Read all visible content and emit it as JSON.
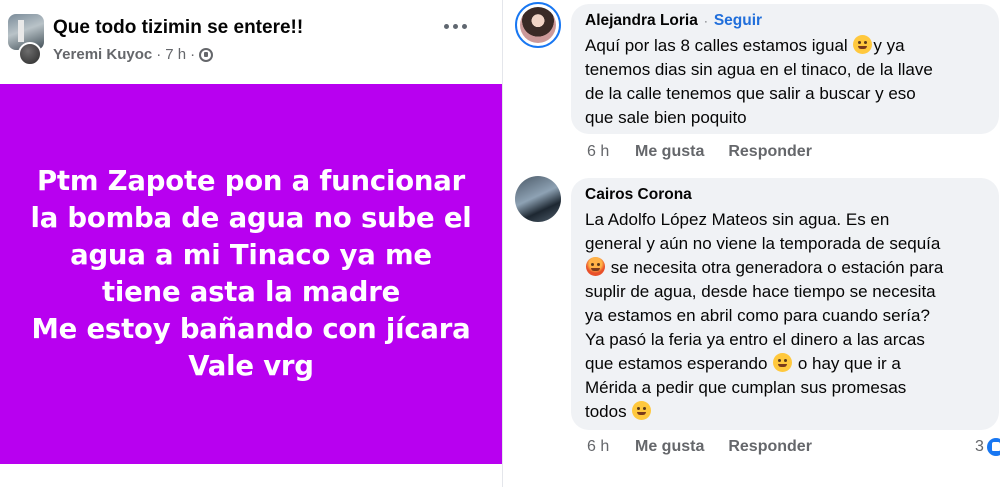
{
  "post": {
    "group_name": "Que todo tizimin se entere!!",
    "author": "Yeremi Kuyoc",
    "separator": "·",
    "time": "7 h",
    "separator2": "·",
    "image_background": "#b800f0",
    "image_text": "Ptm Zapote pon a funcionar\nla bomba de agua no sube el\nagua a mi Tinaco ya me\ntiene asta la madre\nMe estoy bañando con jícara\nVale vrg"
  },
  "comments": [
    {
      "name": "Alejandra Loria",
      "separator": "·",
      "follow_label": "Seguir",
      "text_before_emoji": "Aquí por las 8 calles estamos igual ",
      "emoji": "hugging-face-icon",
      "text_after_emoji": "y ya\ntenemos dias sin agua en el tinaco, de la llave\nde la calle tenemos que salir a buscar y eso\nque sale bien poquito",
      "time": "6 h",
      "like_label": "Me gusta",
      "reply_label": "Responder"
    },
    {
      "name": "Cairos Corona",
      "text_part1": "La Adolfo López Mateos sin agua. Es en\ngeneral y aún no viene la temporada de sequía\n",
      "text_part2": " se necesita otra generadora o estación para\nsuplir de agua, desde hace tiempo se necesita\nya estamos en abril  como para cuando sería?\nYa pasó la feria ya entro el dinero a las arcas\nque estamos esperando ",
      "text_part3": " o hay que ir a\nMérida a pedir que cumplan sus promesas\ntodos ",
      "time": "6 h",
      "like_label": "Me gusta",
      "reply_label": "Responder",
      "reaction_count": "3"
    }
  ],
  "colors": {
    "link_blue": "#216fdb",
    "bubble_gray": "#f0f2f5",
    "meta_gray": "#65676b"
  }
}
